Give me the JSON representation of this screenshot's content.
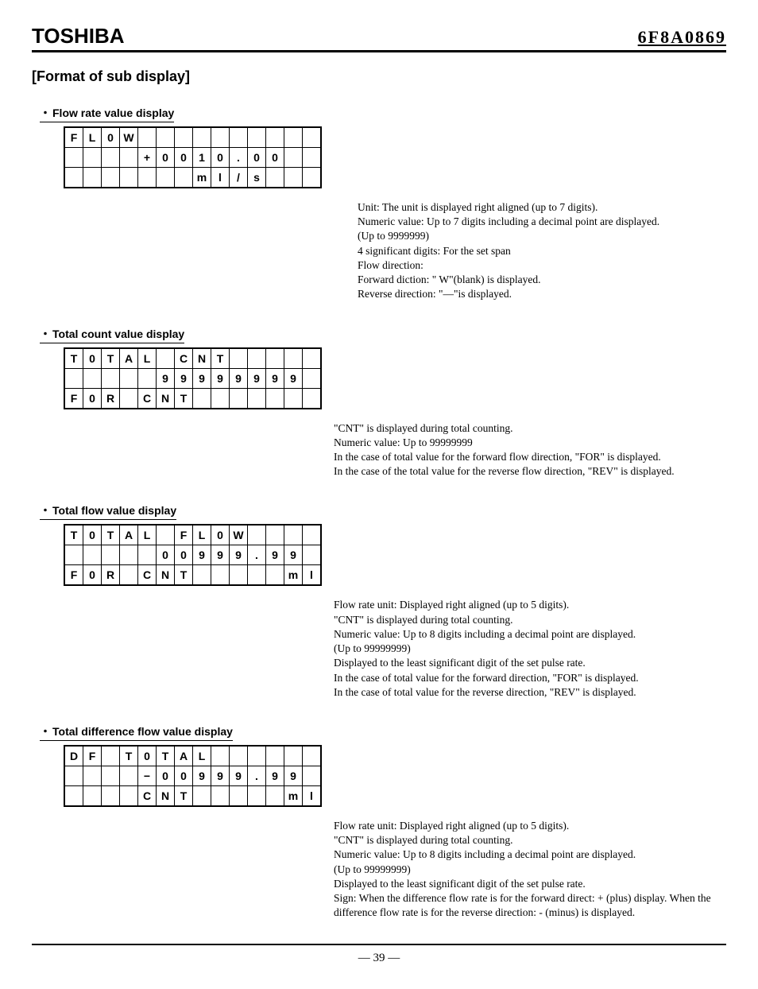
{
  "header": {
    "brand": "TOSHIBA",
    "docnum": "6F8A0869"
  },
  "section_title": "[Format of sub display]",
  "blocks": {
    "flow_rate": {
      "title": "Flow rate value display",
      "grid": [
        [
          "F",
          "L",
          "0",
          "W",
          "",
          "",
          "",
          "",
          "",
          "",
          "",
          "",
          "",
          ""
        ],
        [
          "",
          "",
          "",
          "",
          "+",
          "0",
          "0",
          "1",
          "0",
          ".",
          "0",
          "0",
          "",
          ""
        ],
        [
          "",
          "",
          "",
          "",
          "",
          "",
          "",
          "m",
          "l",
          "/",
          "s",
          "",
          "",
          ""
        ]
      ],
      "notes": "Unit: The unit is displayed right aligned (up to 7 digits).\nNumeric value: Up to 7 digits including a decimal point are displayed.\n  (Up to 9999999)\n4 significant digits: For the set span\nFlow direction:\n  Forward diction: \"   W\"(blank) is displayed.\n  Reverse direction: \"—\"is displayed."
    },
    "total_count": {
      "title": "Total count value display",
      "grid": [
        [
          "T",
          "0",
          "T",
          "A",
          "L",
          "",
          "C",
          "N",
          "T",
          "",
          "",
          "",
          "",
          ""
        ],
        [
          "",
          "",
          "",
          "",
          "",
          "9",
          "9",
          "9",
          "9",
          "9",
          "9",
          "9",
          "9",
          ""
        ],
        [
          "F",
          "0",
          "R",
          "",
          "C",
          "N",
          "T",
          "",
          "",
          "",
          "",
          "",
          "",
          ""
        ]
      ],
      "notes": "\"CNT\" is displayed during total counting.\nNumeric value: Up to 99999999\nIn the case of total value for the forward flow direction, \"FOR\" is displayed.\nIn the case of the total value for the reverse flow direction, \"REV\" is displayed."
    },
    "total_flow": {
      "title": "Total flow value display",
      "grid": [
        [
          "T",
          "0",
          "T",
          "A",
          "L",
          "",
          "F",
          "L",
          "0",
          "W",
          "",
          "",
          "",
          ""
        ],
        [
          "",
          "",
          "",
          "",
          "",
          "0",
          "0",
          "9",
          "9",
          "9",
          ".",
          "9",
          "9",
          ""
        ],
        [
          "F",
          "0",
          "R",
          "",
          "C",
          "N",
          "T",
          "",
          "",
          "",
          "",
          "",
          "m",
          "l"
        ]
      ],
      "notes": "Flow rate unit: Displayed right aligned (up to 5 digits).\n\"CNT\" is displayed during total counting.\nNumeric value: Up to 8 digits including a decimal point are displayed.\n  (Up to 99999999)\nDisplayed to the least significant digit of the set pulse rate.\nIn the case of total value for the forward direction, \"FOR\" is displayed.\nIn the case of total value for the reverse direction, \"REV\" is displayed."
    },
    "total_diff": {
      "title": "Total difference flow value display",
      "grid": [
        [
          "D",
          "F",
          "",
          "T",
          "0",
          "T",
          "A",
          "L",
          "",
          "",
          "",
          "",
          "",
          ""
        ],
        [
          "",
          "",
          "",
          "",
          "−",
          "0",
          "0",
          "9",
          "9",
          "9",
          ".",
          "9",
          "9",
          ""
        ],
        [
          "",
          "",
          "",
          "",
          "C",
          "N",
          "T",
          "",
          "",
          "",
          "",
          "",
          "m",
          "l"
        ]
      ],
      "notes": "Flow rate unit: Displayed right aligned (up to 5 digits).\n\"CNT\" is displayed during total counting.\nNumeric value: Up to 8 digits including a decimal point are displayed.\n  (Up to 99999999)\nDisplayed to the least significant digit of the set pulse rate.\nSign: When the difference flow rate is for the forward direct: + (plus) display. When the difference flow rate is for the reverse direction: - (minus) is displayed."
    }
  },
  "page_number": "—   39   —"
}
